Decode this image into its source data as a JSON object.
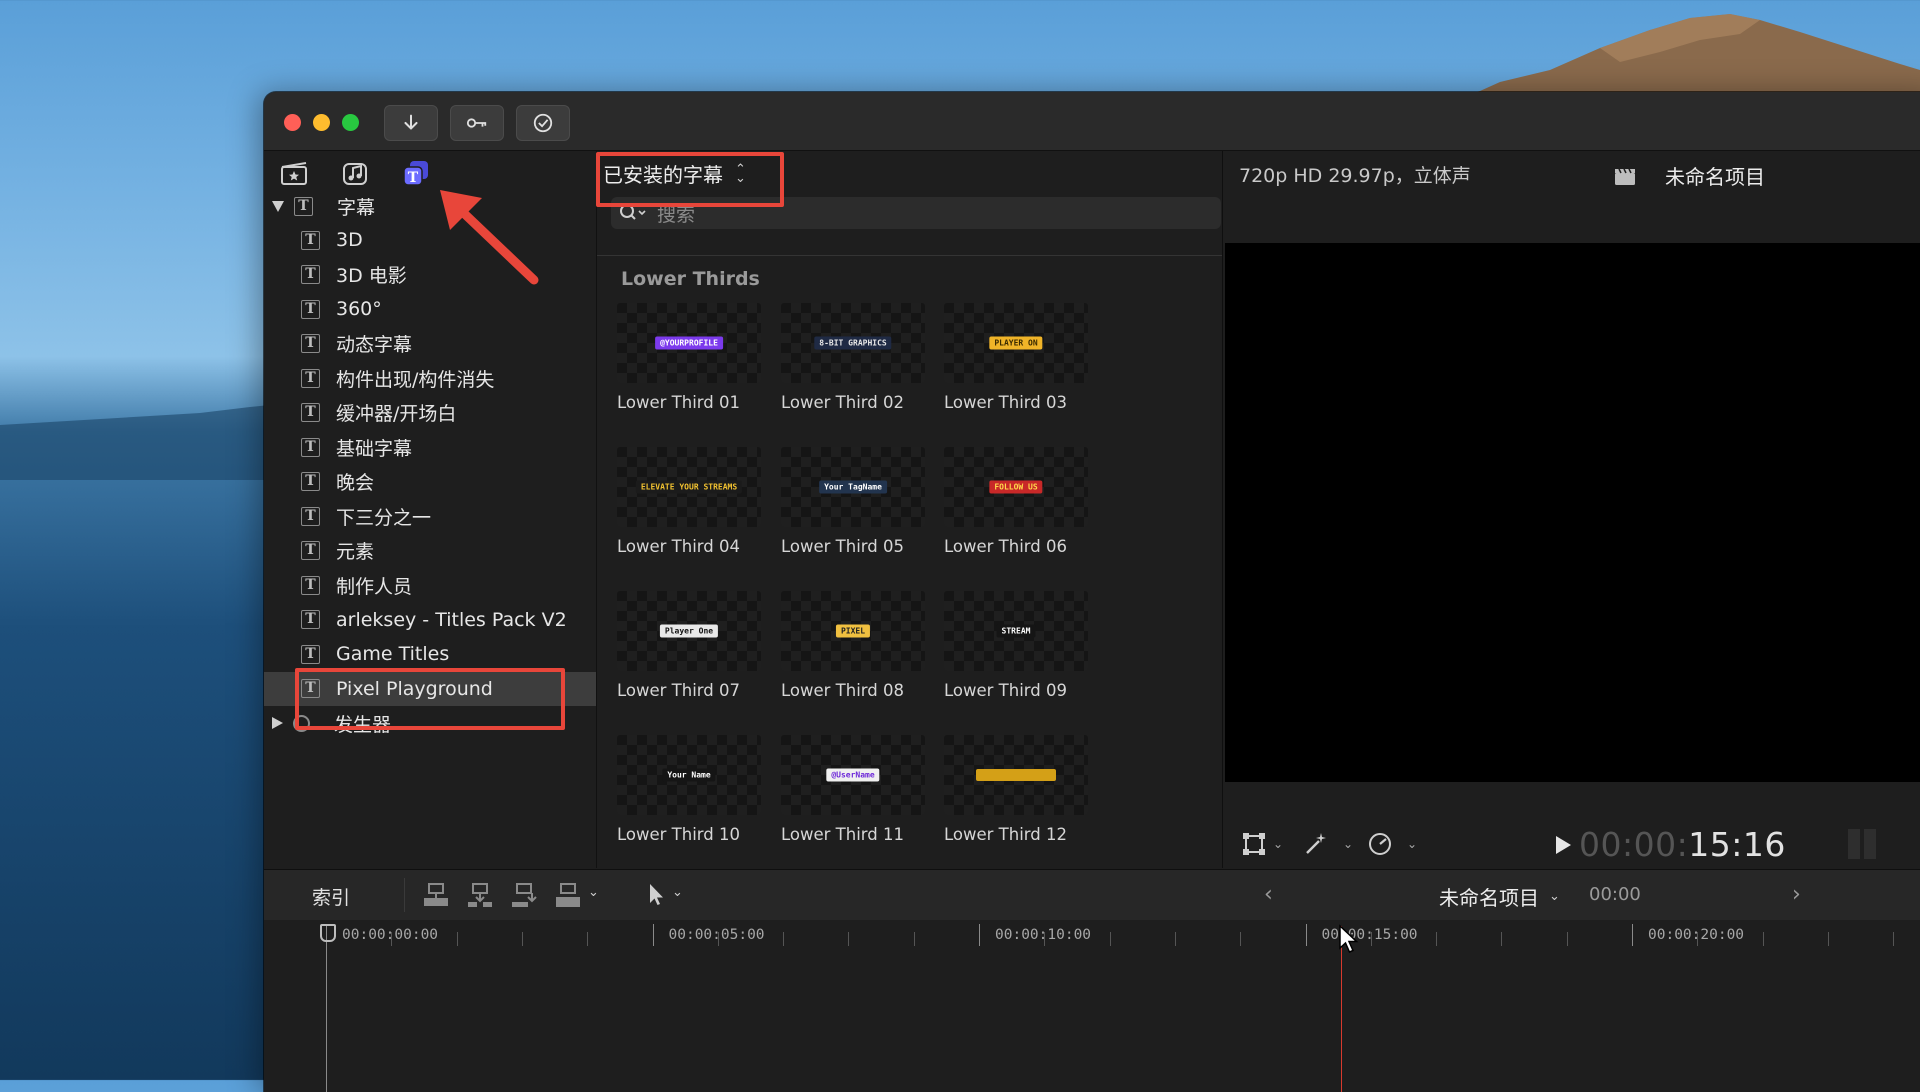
{
  "toolbar": {
    "import_icon": "arrow-down-icon",
    "keywords_icon": "key-icon",
    "background_tasks_icon": "checkmark-circle-icon"
  },
  "sidebar": {
    "tabs": [
      "media-browser-icon",
      "music-sound-icon",
      "titles-generators-icon"
    ],
    "active_tab": "titles-generators-icon",
    "root": "字幕",
    "items": [
      "3D",
      "3D 电影",
      "360°",
      "动态字幕",
      "构件出现/构件消失",
      "缓冲器/开场白",
      "基础字幕",
      "晚会",
      "下三分之一",
      "元素",
      "制作人员",
      "arleksey - Titles Pack V2",
      "Game Titles",
      "Pixel Playground"
    ],
    "selected": "Pixel Playground",
    "generators_label": "发生器"
  },
  "browser": {
    "source": "已安装的字幕",
    "search_placeholder": "搜索",
    "section": "Lower Thirds",
    "clips": [
      {
        "name": "Lower Third 01",
        "thumb_text": "@YOURPROFILE",
        "thumb_color": "#7c3aed",
        "thumb_text_color": "#ffffff"
      },
      {
        "name": "Lower Third 02",
        "thumb_text": "8-BIT GRAPHICS",
        "thumb_color": "#1f2a44",
        "thumb_text_color": "#e8e8e8"
      },
      {
        "name": "Lower Third 03",
        "thumb_text": "PLAYER ON",
        "thumb_color": "#f0b428",
        "thumb_text_color": "#3a2a00"
      },
      {
        "name": "Lower Third 04",
        "thumb_text": "ELEVATE YOUR STREAMS",
        "thumb_color": "#1b1b1b",
        "thumb_text_color": "#f2c230"
      },
      {
        "name": "Lower Third 05",
        "thumb_text": "Your TagName",
        "thumb_color": "#22344e",
        "thumb_text_color": "#ffffff"
      },
      {
        "name": "Lower Third 06",
        "thumb_text": "FOLLOW US",
        "thumb_color": "#c82828",
        "thumb_text_color": "#ffd84a"
      },
      {
        "name": "Lower Third 07",
        "thumb_text": "Player One",
        "thumb_color": "#e8e8e8",
        "thumb_text_color": "#111111"
      },
      {
        "name": "Lower Third 08",
        "thumb_text": "PIXEL",
        "thumb_color": "#f0c040",
        "thumb_text_color": "#222222"
      },
      {
        "name": "Lower Third 09",
        "thumb_text": "STREAM",
        "thumb_color": "#151515",
        "thumb_text_color": "#ffffff"
      },
      {
        "name": "Lower Third 10",
        "thumb_text": "Your Name",
        "thumb_color": "#151515",
        "thumb_text_color": "#ffffff"
      },
      {
        "name": "Lower Third 11",
        "thumb_text": "@UserName",
        "thumb_color": "#f0f0f0",
        "thumb_text_color": "#6d28d9"
      },
      {
        "name": "Lower Third 12",
        "thumb_text": "",
        "thumb_color": "#d4a017",
        "thumb_text_color": "#222222"
      }
    ]
  },
  "viewer": {
    "format": "720p HD 29.97p，立体声",
    "project": "未命名项目",
    "timecode_dim": "00:00:",
    "timecode_live": "15:16"
  },
  "timeline": {
    "index_label": "索引",
    "project": "未命名项目",
    "duration": "00:00",
    "ruler": [
      "00:00:00:00",
      "00:00:05:00",
      "00:00:10:00",
      "00:00:15:00",
      "00:00:20:00"
    ]
  },
  "colors": {
    "annotation": "#e8463a",
    "playhead": "#d83a2e",
    "active_tab": "#6b6bff"
  }
}
